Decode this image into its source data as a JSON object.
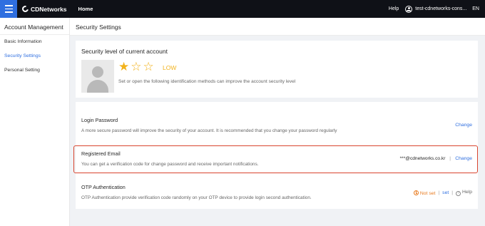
{
  "topbar": {
    "brand": "CDNetworks",
    "home": "Home",
    "help": "Help",
    "user": "test-cdnetworks-cons...",
    "language": "EN"
  },
  "sidebar": {
    "title": "Account Management",
    "items": [
      {
        "label": "Basic Information"
      },
      {
        "label": "Security Settings"
      },
      {
        "label": "Personal Setting"
      }
    ]
  },
  "page": {
    "title": "Security Settings"
  },
  "security_level": {
    "title": "Security level of current account",
    "rating": 1,
    "rating_max": 3,
    "level": "LOW",
    "description": "Set or open the following identification methods can improve the account security level"
  },
  "login_password": {
    "title": "Login Password",
    "description": "A more secure password will improve the security of your account. It is recommended that you change your password regularly",
    "action": "Change"
  },
  "registered_email": {
    "title": "Registered Email",
    "description": "You can get a verification code for change password and receive important notifications.",
    "value": "***@cdnetworks.co.kr",
    "separator": "|",
    "action": "Change"
  },
  "otp": {
    "title": "OTP Authentication",
    "description": "OTP Authentication provide verification code randomly on your OTP device to provide login second authentication.",
    "status": "Not set",
    "separator": "|",
    "set_action": "set",
    "help_action": "Help"
  },
  "colors": {
    "accent": "#2f6fe0",
    "star": "#f2b21b",
    "highlight_border": "#d9452f",
    "warning": "#e8791c"
  }
}
